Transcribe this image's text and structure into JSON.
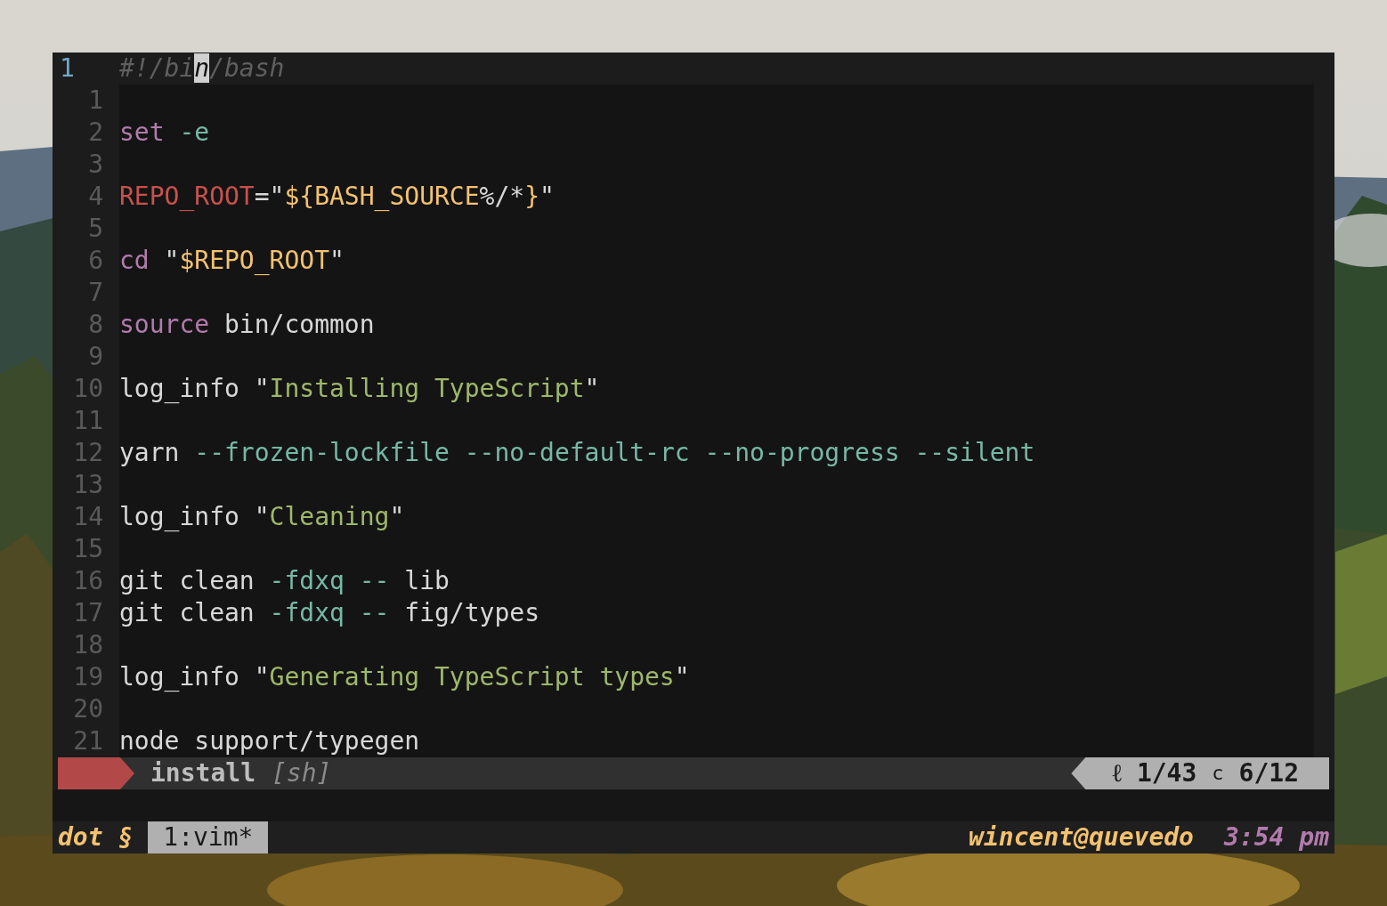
{
  "editor": {
    "lines": [
      {
        "number": "1",
        "current": true,
        "tokens": [
          {
            "text": "#!/bi",
            "kind": "comment"
          },
          {
            "text": "n",
            "kind": "cursor"
          },
          {
            "text": "/bash",
            "kind": "comment"
          }
        ]
      },
      {
        "number": "1",
        "current": false
      },
      {
        "number": "2",
        "current": false,
        "tokens": [
          {
            "text": "set",
            "kind": "keyword"
          },
          {
            "text": " -e",
            "kind": "flag"
          }
        ]
      },
      {
        "number": "3",
        "current": false
      },
      {
        "number": "4",
        "current": false,
        "tokens": [
          {
            "text": "REPO_ROOT",
            "kind": "variable"
          },
          {
            "text": "=\"",
            "kind": "plain"
          },
          {
            "text": "${BASH_SOURCE",
            "kind": "expansion"
          },
          {
            "text": "%/*",
            "kind": "plain"
          },
          {
            "text": "}",
            "kind": "expansion"
          },
          {
            "text": "\"",
            "kind": "plain"
          }
        ]
      },
      {
        "number": "5",
        "current": false
      },
      {
        "number": "6",
        "current": false,
        "tokens": [
          {
            "text": "cd",
            "kind": "keyword"
          },
          {
            "text": " \"",
            "kind": "plain"
          },
          {
            "text": "$REPO_ROOT",
            "kind": "expansion"
          },
          {
            "text": "\"",
            "kind": "plain"
          }
        ]
      },
      {
        "number": "7",
        "current": false
      },
      {
        "number": "8",
        "current": false,
        "tokens": [
          {
            "text": "source",
            "kind": "keyword"
          },
          {
            "text": " bin/common",
            "kind": "plain"
          }
        ]
      },
      {
        "number": "9",
        "current": false
      },
      {
        "number": "10",
        "current": false,
        "tokens": [
          {
            "text": "log_info \"",
            "kind": "plain"
          },
          {
            "text": "Installing TypeScript",
            "kind": "string"
          },
          {
            "text": "\"",
            "kind": "plain"
          }
        ]
      },
      {
        "number": "11",
        "current": false
      },
      {
        "number": "12",
        "current": false,
        "tokens": [
          {
            "text": "yarn ",
            "kind": "plain"
          },
          {
            "text": "--frozen-lockfile --no-default-rc --no-progress --silent",
            "kind": "flag"
          }
        ]
      },
      {
        "number": "13",
        "current": false
      },
      {
        "number": "14",
        "current": false,
        "tokens": [
          {
            "text": "log_info \"",
            "kind": "plain"
          },
          {
            "text": "Cleaning",
            "kind": "string"
          },
          {
            "text": "\"",
            "kind": "plain"
          }
        ]
      },
      {
        "number": "15",
        "current": false
      },
      {
        "number": "16",
        "current": false,
        "tokens": [
          {
            "text": "git clean ",
            "kind": "plain"
          },
          {
            "text": "-fdxq --",
            "kind": "flag"
          },
          {
            "text": " lib",
            "kind": "plain"
          }
        ]
      },
      {
        "number": "17",
        "current": false,
        "tokens": [
          {
            "text": "git clean ",
            "kind": "plain"
          },
          {
            "text": "-fdxq --",
            "kind": "flag"
          },
          {
            "text": " fig/types",
            "kind": "plain"
          }
        ]
      },
      {
        "number": "18",
        "current": false
      },
      {
        "number": "19",
        "current": false,
        "tokens": [
          {
            "text": "log_info \"",
            "kind": "plain"
          },
          {
            "text": "Generating TypeScript types",
            "kind": "string"
          },
          {
            "text": "\"",
            "kind": "plain"
          }
        ]
      },
      {
        "number": "20",
        "current": false
      },
      {
        "number": "21",
        "current": false,
        "tokens": [
          {
            "text": "node support/typegen",
            "kind": "plain"
          }
        ]
      }
    ]
  },
  "statusline": {
    "file": "install",
    "filetype": "[sh]",
    "line_icon": "ℓ",
    "line": "1/43",
    "col_label": "c",
    "col": "6/12"
  },
  "tmux": {
    "session": "dot §",
    "windows": [
      {
        "label": "1:vim*",
        "selected": true
      }
    ],
    "host": "wincent@quevedo",
    "time": "3:54 pm"
  }
}
